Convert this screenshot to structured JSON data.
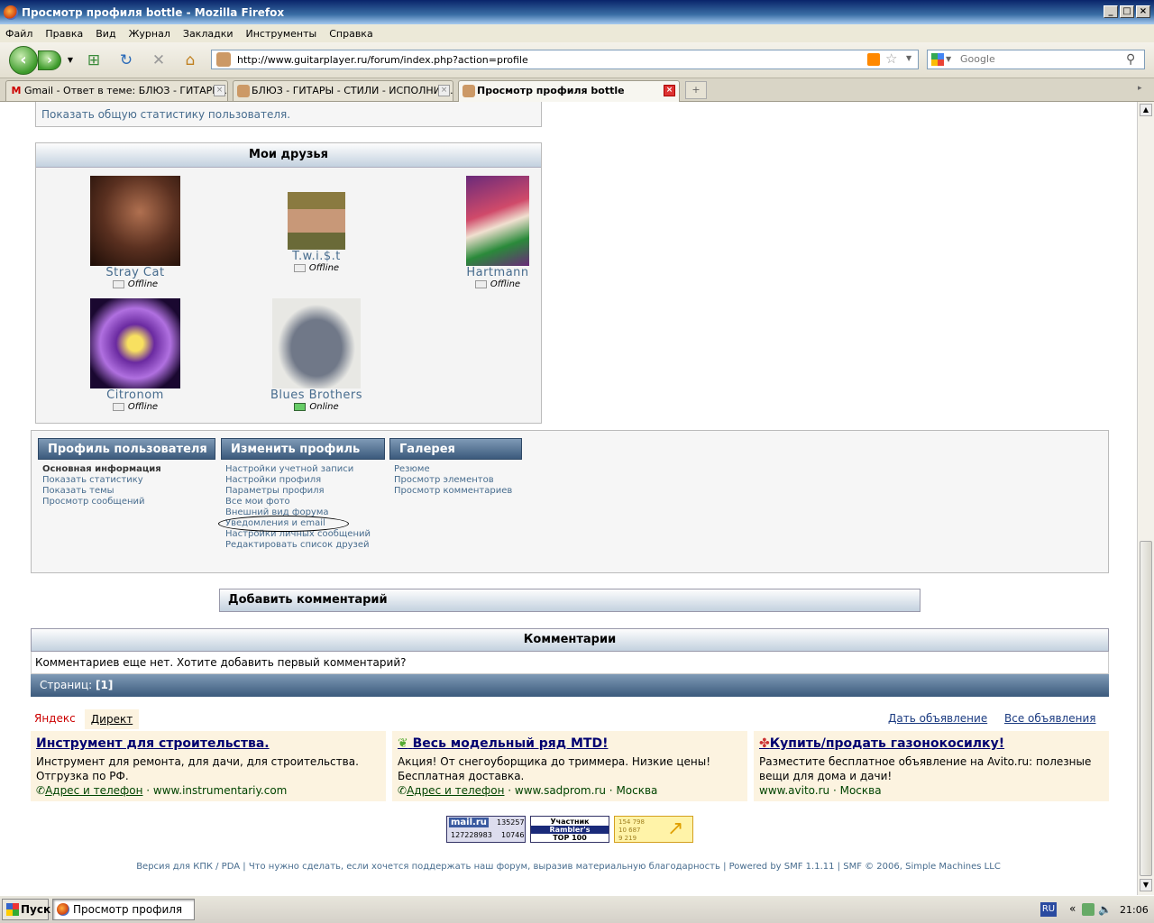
{
  "window": {
    "title": "Просмотр профиля bottle - Mozilla Firefox"
  },
  "menu": [
    "Файл",
    "Правка",
    "Вид",
    "Журнал",
    "Закладки",
    "Инструменты",
    "Справка"
  ],
  "url": "http://www.guitarplayer.ru/forum/index.php?action=profile",
  "search_placeholder": "Google",
  "tabs": [
    {
      "label": "Gmail - Ответ в теме: БЛЮЗ - ГИТАРЫ..."
    },
    {
      "label": "БЛЮЗ - ГИТАРЫ - СТИЛИ - ИСПОЛНИТ..."
    },
    {
      "label": "Просмотр профиля bottle"
    }
  ],
  "stats_partial": "Показать общую статистику пользователя.",
  "friends": {
    "title": "Мои друзья",
    "items": [
      {
        "name": "Stray Cat",
        "status": "Offline"
      },
      {
        "name": "T.w.i.$.t",
        "status": "Offline"
      },
      {
        "name": "Hartmann",
        "status": "Offline"
      },
      {
        "name": "Citronom",
        "status": "Offline"
      },
      {
        "name": "Blues Brothers",
        "status": "Online"
      }
    ]
  },
  "profile_menu": {
    "profile": {
      "title": "Профиль пользователя",
      "items": [
        "Основная информация",
        "Показать статистику",
        "Показать темы",
        "Просмотр сообщений"
      ]
    },
    "edit": {
      "title": "Изменить профиль",
      "items": [
        "Настройки учетной записи",
        "Настройки профиля",
        "Параметры профиля",
        "Все мои фото",
        "Внешний вид форума",
        "Уведомления и email",
        "Настройки личных сообщений",
        "Редактировать список друзей"
      ]
    },
    "gallery": {
      "title": "Галерея",
      "items": [
        "Резюме",
        "Просмотр элементов",
        "Просмотр комментариев"
      ]
    }
  },
  "add_comment": "Добавить комментарий",
  "comments": {
    "title": "Комментарии",
    "empty": "Комментариев еще нет. Хотите добавить первый комментарий?",
    "pages_label": "Страниц:",
    "pages_value": "[1]"
  },
  "ads": {
    "yandex": "Яндекс",
    "direct": "Директ",
    "post_ad": "Дать объявление",
    "all_ads": "Все объявления",
    "items": [
      {
        "title": "Инструмент для строительства.",
        "text": "Инструмент для ремонта, для дачи, для строительства. Отгрузка по РФ.",
        "contact": "Адрес и телефон",
        "site": "www.instrumentariy.com",
        "city": ""
      },
      {
        "title": "Весь модельный ряд MTD!",
        "text": "Акция! От снегоуборщика до триммера. Низкие цены! Бесплатная доставка.",
        "contact": "Адрес и телефон",
        "site": "www.sadprom.ru",
        "city": "Москва"
      },
      {
        "title": "Купить/продать газонокосилку!",
        "text": "Разместите бесплатное объявление на Avito.ru: полезные вещи для дома и дачи!",
        "contact": "",
        "site": "www.avito.ru",
        "city": "Москва"
      }
    ]
  },
  "counters": {
    "mailru": {
      "brand": "mail.ru",
      "a": "135257",
      "b": "127228983",
      "c": "10746"
    },
    "rambler": {
      "l1": "Участник",
      "l2": "Rambler's",
      "l3": "TOP 100"
    },
    "liveinternet": {
      "a": "154 798",
      "b": "10 687",
      "c": "9 219"
    }
  },
  "footer": {
    "pda": "Версия для КПК / PDA",
    "help": "Что нужно сделать, если хочется поддержать наш форум, выразив материальную благодарность",
    "powered": "Powered by SMF 1.1.11",
    "copy": "SMF © 2006, Simple Machines LLC"
  },
  "taskbar": {
    "start": "Пуск",
    "task": "Просмотр профиля b...",
    "lang": "RU",
    "time": "21:06"
  }
}
